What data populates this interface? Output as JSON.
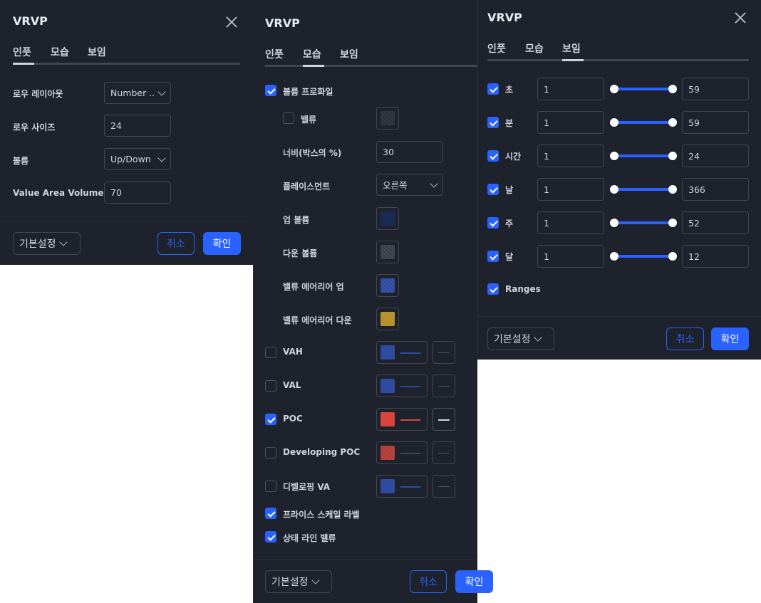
{
  "panel1": {
    "title": "VRVP",
    "tabs": [
      "인풋",
      "모습",
      "보임"
    ],
    "rows": [
      {
        "label": "로우 레이아웃",
        "value": "Number ...",
        "type": "select"
      },
      {
        "label": "로우 사이즈",
        "value": "24",
        "type": "input"
      },
      {
        "label": "볼륨",
        "value": "Up/Down",
        "type": "select"
      },
      {
        "label": "Value Area Volume",
        "value": "70",
        "type": "input"
      }
    ],
    "footer": {
      "defaults": "기본설정",
      "cancel": "취소",
      "ok": "확인"
    }
  },
  "panel2": {
    "title": "VRVP",
    "tabs": [
      "인풋",
      "모습",
      "보임"
    ],
    "volume_profile": {
      "label": "볼륨 프로화일",
      "checked": true
    },
    "value": {
      "label": "밸류",
      "checked": false,
      "color": "#2a2e39"
    },
    "width": {
      "label": "너비(박스의 %)",
      "value": "30"
    },
    "placement": {
      "label": "플레이스먼트",
      "value": "오른쪽"
    },
    "up_volume": {
      "label": "업 볼륨",
      "color": "#1b2a55"
    },
    "down_volume": {
      "label": "다운 볼륨",
      "color": "#3a3d47"
    },
    "va_up": {
      "label": "밸류 에어리어 업",
      "color": "#2e4ba0"
    },
    "va_down": {
      "label": "밸류 에어리어 다운",
      "color": "#b8912f"
    },
    "lines": [
      {
        "label": "VAH",
        "checked": false,
        "color": "#2e4ba0",
        "line": "#2e4ba0"
      },
      {
        "label": "VAL",
        "checked": false,
        "color": "#2e4ba0",
        "line": "#2e4ba0"
      },
      {
        "label": "POC",
        "checked": true,
        "color": "#d9453a",
        "line": "#d9453a"
      },
      {
        "label": "Developing POC",
        "checked": false,
        "color": "#b23a35",
        "line": "#434651"
      },
      {
        "label": "디벨로핑 VA",
        "checked": false,
        "color": "#2e4ba0",
        "line": "#2e4ba0"
      }
    ],
    "price_scale_label": {
      "label": "프라이스 스케일 라벨",
      "checked": true
    },
    "status_line_value": {
      "label": "상태 라인 밸류",
      "checked": true
    },
    "footer": {
      "defaults": "기본설정",
      "cancel": "취소",
      "ok": "확인"
    }
  },
  "panel3": {
    "title": "VRVP",
    "tabs": [
      "인풋",
      "모습",
      "보임"
    ],
    "rows": [
      {
        "label": "초",
        "checked": true,
        "min": "1",
        "max": "59"
      },
      {
        "label": "분",
        "checked": true,
        "min": "1",
        "max": "59"
      },
      {
        "label": "시간",
        "checked": true,
        "min": "1",
        "max": "24"
      },
      {
        "label": "날",
        "checked": true,
        "min": "1",
        "max": "366"
      },
      {
        "label": "주",
        "checked": true,
        "min": "1",
        "max": "52"
      },
      {
        "label": "달",
        "checked": true,
        "min": "1",
        "max": "12"
      }
    ],
    "ranges": {
      "label": "Ranges",
      "checked": true
    },
    "footer": {
      "defaults": "기본설정",
      "cancel": "취소",
      "ok": "확인"
    }
  }
}
